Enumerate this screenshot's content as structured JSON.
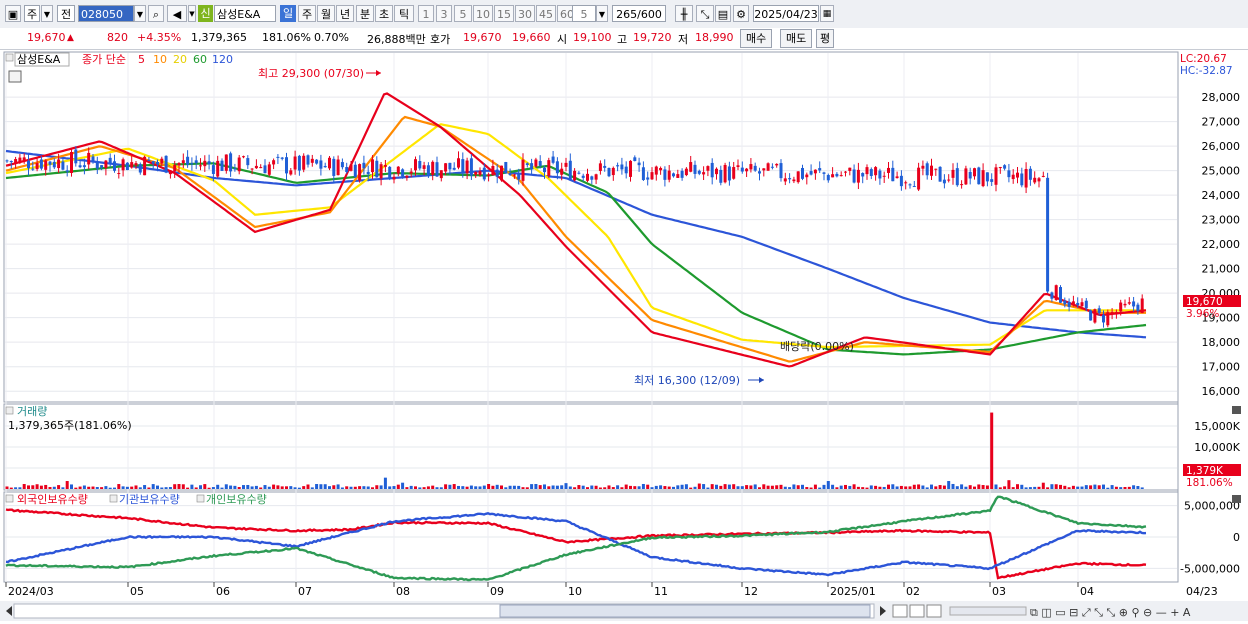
{
  "toolbar": {
    "period_type": "주",
    "prev": "전",
    "code": "028050",
    "new_badge": "신",
    "name": "삼성E&A",
    "tf_day": "일",
    "tf_week": "주",
    "tf_month": "월",
    "tf_year": "년",
    "tf_min": "분",
    "tf_sec": "초",
    "tf_tick": "틱",
    "n1": "1",
    "n3": "3",
    "n5": "5",
    "n10": "10",
    "n15": "15",
    "n30": "30",
    "n45": "45",
    "n60": "60",
    "interval_value": "5",
    "count": "265",
    "count_total": "/600",
    "date": "2025/04/23",
    "icon_candle": "candle-icon",
    "icon_tools": "tools-icon",
    "icon_save": "save-icon",
    "icon_settings": "gear-icon"
  },
  "quote": {
    "price": "19,670",
    "arrow": "▲",
    "change": "820",
    "change_pct": "+4.35%",
    "volume": "1,379,365",
    "vol_ratio": "181.06%",
    "turnover_pct": "0.70%",
    "amount": "26,888백만",
    "ask_label": "호가",
    "ask": "19,670",
    "bid": "19,660",
    "open_label": "시",
    "open": "19,100",
    "high_label": "고",
    "high": "19,720",
    "low_label": "저",
    "low": "18,990",
    "buy": "매수",
    "sell": "매도",
    "flat": "평"
  },
  "colors": {
    "up": "#e8001c",
    "down": "#1f5fd6",
    "ma5": "#e8001c",
    "ma10": "#ff8a00",
    "ma20": "#ffe600",
    "ma60": "#1e9a2e",
    "ma120": "#2c55d8"
  },
  "price_panel": {
    "stock_label": "삼성E&A",
    "ma_label": "종가 단순",
    "ma_periods": [
      "5",
      "10",
      "20",
      "60",
      "120"
    ],
    "lc": "LC:20.67",
    "hc": "HC:-32.87",
    "high_note": "최고 29,300 (07/30)",
    "low_note": "최저 16,300 (12/09)",
    "dividend_note": "배당락(0.00%)",
    "last_price": "19,670",
    "last_pct": "3.96%"
  },
  "volume_panel": {
    "title": "거래량",
    "info": "1,379,365주(181.06%)",
    "last_tag": "1,379K",
    "last_pct": "181.06%"
  },
  "flow_panel": {
    "labels": [
      "외국인보유수량",
      "기관보유수량",
      "개인보유수량"
    ]
  },
  "x_axis": {
    "labels": [
      "2024/03",
      "05",
      "06",
      "07",
      "08",
      "09",
      "10",
      "11",
      "12",
      "2025/01",
      "02",
      "03",
      "04"
    ],
    "end_label": "04/23"
  },
  "chart_data": [
    {
      "type": "candlestick",
      "title": "삼성E&A",
      "legend": [
        "종가 단순 5",
        "10",
        "20",
        "60",
        "120"
      ],
      "ylim": [
        15600,
        29800
      ],
      "yticks": [
        "16,000",
        "17,000",
        "18,000",
        "19,000",
        "20,000",
        "21,000",
        "22,000",
        "23,000",
        "24,000",
        "25,000",
        "26,000",
        "27,000",
        "28,000"
      ],
      "close_path": [
        [
          "2024/03",
          25400
        ],
        [
          "03/20",
          24700
        ],
        [
          "04/05",
          25900
        ],
        [
          "04/20",
          26300
        ],
        [
          "05",
          26000
        ],
        [
          "05/20",
          24700
        ],
        [
          "06",
          24100
        ],
        [
          "06/20",
          22500
        ],
        [
          "07",
          23500
        ],
        [
          "07/15",
          23500
        ],
        [
          "07/22",
          25400
        ],
        [
          "07/30",
          28300
        ],
        [
          "08/05",
          25900
        ],
        [
          "08/20",
          26900
        ],
        [
          "09",
          26000
        ],
        [
          "09/10",
          23800
        ],
        [
          "09/25",
          24100
        ],
        [
          "10",
          21700
        ],
        [
          "10/20",
          20700
        ],
        [
          "11",
          18300
        ],
        [
          "11/20",
          17700
        ],
        [
          "12",
          18300
        ],
        [
          "12/09",
          17300
        ],
        [
          "12/20",
          16900
        ],
        [
          "2025/01",
          17700
        ],
        [
          "01/20",
          18300
        ],
        [
          "02",
          17800
        ],
        [
          "02/20",
          18300
        ],
        [
          "03",
          17200
        ],
        [
          "03/10",
          18300
        ],
        [
          "03/20",
          20300
        ],
        [
          "04",
          19400
        ],
        [
          "04/10",
          19000
        ],
        [
          "04/23",
          19670
        ]
      ],
      "ma5": [
        [
          "2024/03",
          25200
        ],
        [
          "04/20",
          26200
        ],
        [
          "05/20",
          24900
        ],
        [
          "06/20",
          22500
        ],
        [
          "07/15",
          23400
        ],
        [
          "07/30",
          28200
        ],
        [
          "08/20",
          26800
        ],
        [
          "09/10",
          24000
        ],
        [
          "10",
          21900
        ],
        [
          "11",
          18400
        ],
        [
          "12/20",
          17000
        ],
        [
          "01/20",
          18200
        ],
        [
          "03",
          17500
        ],
        [
          "03/20",
          20000
        ],
        [
          "04/10",
          19100
        ],
        [
          "04/23",
          19300
        ]
      ],
      "ma10": [
        [
          "2024/03",
          25000
        ],
        [
          "04/20",
          26000
        ],
        [
          "05/20",
          25100
        ],
        [
          "06/20",
          22700
        ],
        [
          "07/15",
          23300
        ],
        [
          "08/05",
          27200
        ],
        [
          "08/20",
          26800
        ],
        [
          "09/10",
          24600
        ],
        [
          "10",
          22300
        ],
        [
          "11",
          18900
        ],
        [
          "12/20",
          17200
        ],
        [
          "01/20",
          18000
        ],
        [
          "03",
          17600
        ],
        [
          "03/20",
          19700
        ],
        [
          "04/10",
          19200
        ],
        [
          "04/23",
          19200
        ]
      ],
      "ma20": [
        [
          "2024/03",
          24900
        ],
        [
          "05",
          25900
        ],
        [
          "06",
          24600
        ],
        [
          "06/20",
          23200
        ],
        [
          "07/15",
          23500
        ],
        [
          "08/20",
          26900
        ],
        [
          "09",
          26500
        ],
        [
          "09/25",
          24700
        ],
        [
          "10/20",
          22300
        ],
        [
          "11",
          19400
        ],
        [
          "12",
          18100
        ],
        [
          "2025/01",
          17800
        ],
        [
          "03",
          17900
        ],
        [
          "03/20",
          19300
        ],
        [
          "04/23",
          19300
        ]
      ],
      "ma60": [
        [
          "2024/03",
          24700
        ],
        [
          "05",
          25200
        ],
        [
          "06",
          25300
        ],
        [
          "07",
          24500
        ],
        [
          "08",
          24900
        ],
        [
          "09",
          24800
        ],
        [
          "09/25",
          25200
        ],
        [
          "10/20",
          24100
        ],
        [
          "11",
          22000
        ],
        [
          "12",
          19200
        ],
        [
          "2025/01",
          17700
        ],
        [
          "02",
          17500
        ],
        [
          "03",
          17700
        ],
        [
          "04",
          18400
        ],
        [
          "04/23",
          18700
        ]
      ],
      "ma120": [
        [
          "2024/03",
          25800
        ],
        [
          "05",
          25200
        ],
        [
          "06",
          24700
        ],
        [
          "07",
          24400
        ],
        [
          "08",
          24700
        ],
        [
          "09",
          25000
        ],
        [
          "10",
          24700
        ],
        [
          "11",
          23200
        ],
        [
          "12",
          22300
        ],
        [
          "2025/01",
          21000
        ],
        [
          "02",
          19800
        ],
        [
          "03",
          18800
        ],
        [
          "04",
          18400
        ],
        [
          "04/23",
          18200
        ]
      ]
    },
    {
      "type": "bar",
      "title": "거래량",
      "yticks": [
        "5,000K",
        "10,000K",
        "15,000K"
      ],
      "ylim": [
        0,
        20000
      ],
      "spikes": [
        [
          "2024/03",
          600
        ],
        [
          "04/05",
          1900
        ],
        [
          "07/30",
          2700
        ],
        [
          "08/05",
          1500
        ],
        [
          "10",
          1400
        ],
        [
          "11/20",
          1300
        ],
        [
          "2025/01",
          1900
        ],
        [
          "02/20",
          1900
        ],
        [
          "03",
          18200
        ],
        [
          "03/10",
          2100
        ],
        [
          "03/20",
          1500
        ],
        [
          "04/23",
          1379
        ]
      ]
    },
    {
      "type": "line",
      "title": "외국인보유수량 기관보유수량 개인보유수량",
      "yticks": [
        "5,000,000",
        "0",
        "-5,000,000"
      ],
      "ylim": [
        -7000000,
        7000000
      ],
      "series": [
        {
          "name": "외국인보유수량",
          "color": "#e8001c",
          "points": [
            [
              "2024/03",
              4300000
            ],
            [
              "05",
              3000000
            ],
            [
              "06",
              1500000
            ],
            [
              "07",
              1000000
            ],
            [
              "07/22",
              1200000
            ],
            [
              "08",
              2300000
            ],
            [
              "09",
              2200000
            ],
            [
              "10",
              -800000
            ],
            [
              "11",
              200000
            ],
            [
              "12",
              500000
            ],
            [
              "2025/01",
              700000
            ],
            [
              "02",
              1000000
            ],
            [
              "03",
              700000
            ],
            [
              "03/05",
              -6500000
            ],
            [
              "04",
              -4200000
            ],
            [
              "04/23",
              -4500000
            ]
          ]
        },
        {
          "name": "기관보유수량",
          "color": "#2c55d8",
          "points": [
            [
              "2024/03",
              -4000000
            ],
            [
              "05",
              0
            ],
            [
              "06",
              0
            ],
            [
              "07",
              -1500000
            ],
            [
              "08",
              2500000
            ],
            [
              "09",
              3700000
            ],
            [
              "10",
              2500000
            ],
            [
              "11",
              -3200000
            ],
            [
              "12",
              -5000000
            ],
            [
              "2025/01",
              -6000000
            ],
            [
              "02",
              -4000000
            ],
            [
              "03",
              -5000000
            ],
            [
              "04",
              1000000
            ],
            [
              "04/23",
              700000
            ]
          ]
        },
        {
          "name": "개인보유수량",
          "color": "#2e9a55",
          "points": [
            [
              "2024/03",
              -4500000
            ],
            [
              "05",
              -4800000
            ],
            [
              "06",
              -3000000
            ],
            [
              "07",
              -1800000
            ],
            [
              "08",
              -6500000
            ],
            [
              "09",
              -6800000
            ],
            [
              "10",
              -2800000
            ],
            [
              "11",
              -100000
            ],
            [
              "12",
              200000
            ],
            [
              "2025/01",
              800000
            ],
            [
              "02",
              2500000
            ],
            [
              "03",
              4200000
            ],
            [
              "03/05",
              6500000
            ],
            [
              "04",
              2200000
            ],
            [
              "04/23",
              1600000
            ]
          ]
        }
      ]
    }
  ]
}
